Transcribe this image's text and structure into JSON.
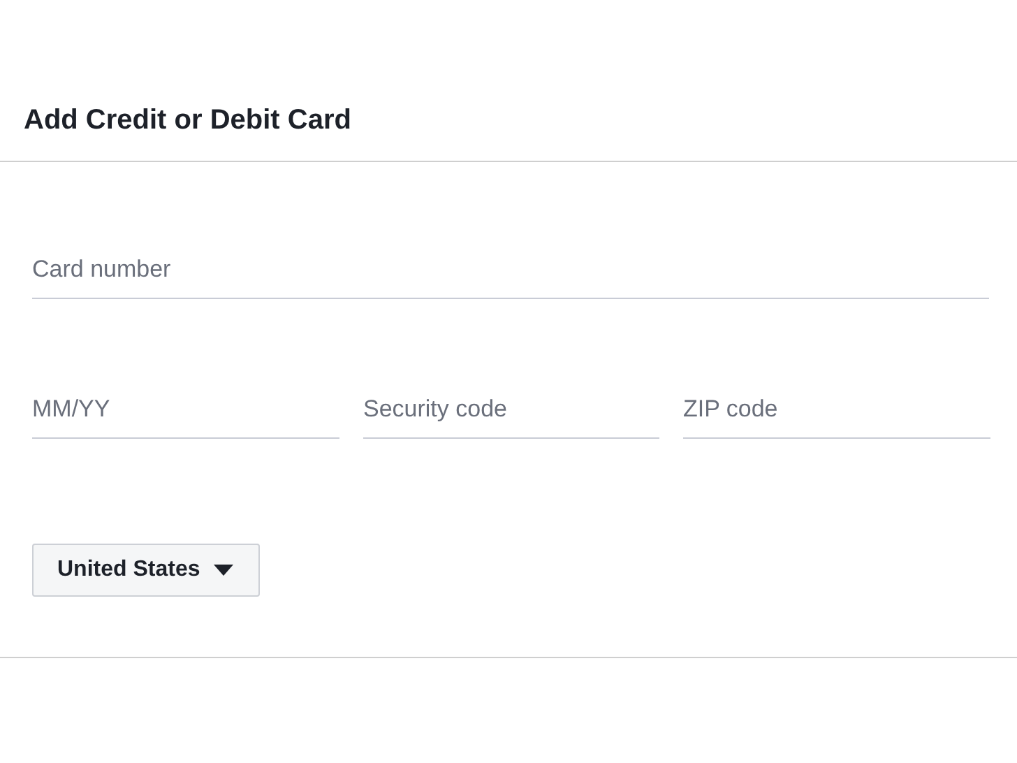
{
  "dialog": {
    "title": "Add Credit or Debit Card"
  },
  "card_number": {
    "placeholder": "Card number"
  },
  "fields": [
    {
      "placeholder": "MM/YY"
    },
    {
      "placeholder": "Security code"
    },
    {
      "placeholder": "ZIP code"
    }
  ],
  "country_select": {
    "value": "United States"
  }
}
